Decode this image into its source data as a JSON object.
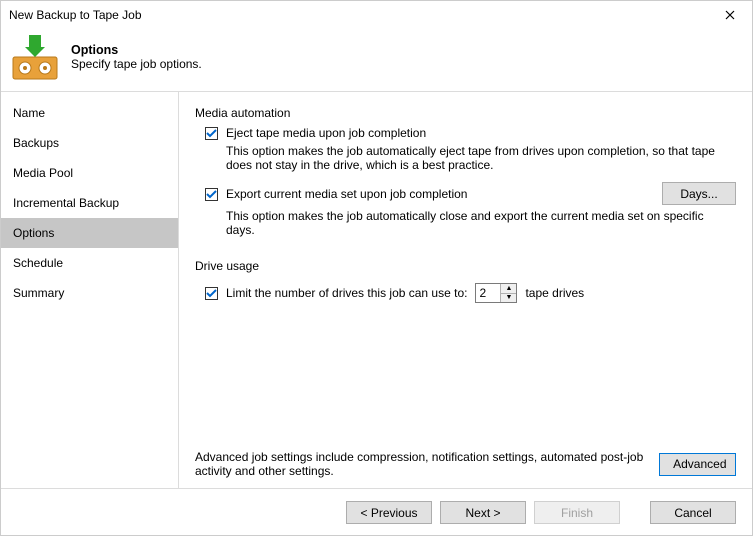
{
  "window": {
    "title": "New Backup to Tape Job"
  },
  "header": {
    "title": "Options",
    "subtitle": "Specify tape job options."
  },
  "sidebar": {
    "items": [
      {
        "label": "Name"
      },
      {
        "label": "Backups"
      },
      {
        "label": "Media Pool"
      },
      {
        "label": "Incremental Backup"
      },
      {
        "label": "Options"
      },
      {
        "label": "Schedule"
      },
      {
        "label": "Summary"
      }
    ],
    "selectedIndex": 4
  },
  "content": {
    "mediaAutomation": {
      "group": "Media automation",
      "eject": {
        "label": "Eject tape media upon job completion",
        "desc": "This option makes the job automatically eject tape from drives upon completion, so that tape does not stay in the drive, which is a best practice.",
        "checked": true
      },
      "export": {
        "label": "Export current media set upon job completion",
        "desc": "This option makes the job automatically close and export the current media set on specific days.",
        "checked": true,
        "daysButton": "Days..."
      }
    },
    "driveUsage": {
      "group": "Drive usage",
      "limit": {
        "label": "Limit the number of drives this job can use to:",
        "value": "2",
        "suffix": "tape drives",
        "checked": true
      }
    },
    "advanced": {
      "text": "Advanced job settings include compression, notification settings, automated post-job activity and other settings.",
      "button": "Advanced"
    }
  },
  "footer": {
    "previous": "< Previous",
    "next": "Next >",
    "finish": "Finish",
    "cancel": "Cancel"
  }
}
